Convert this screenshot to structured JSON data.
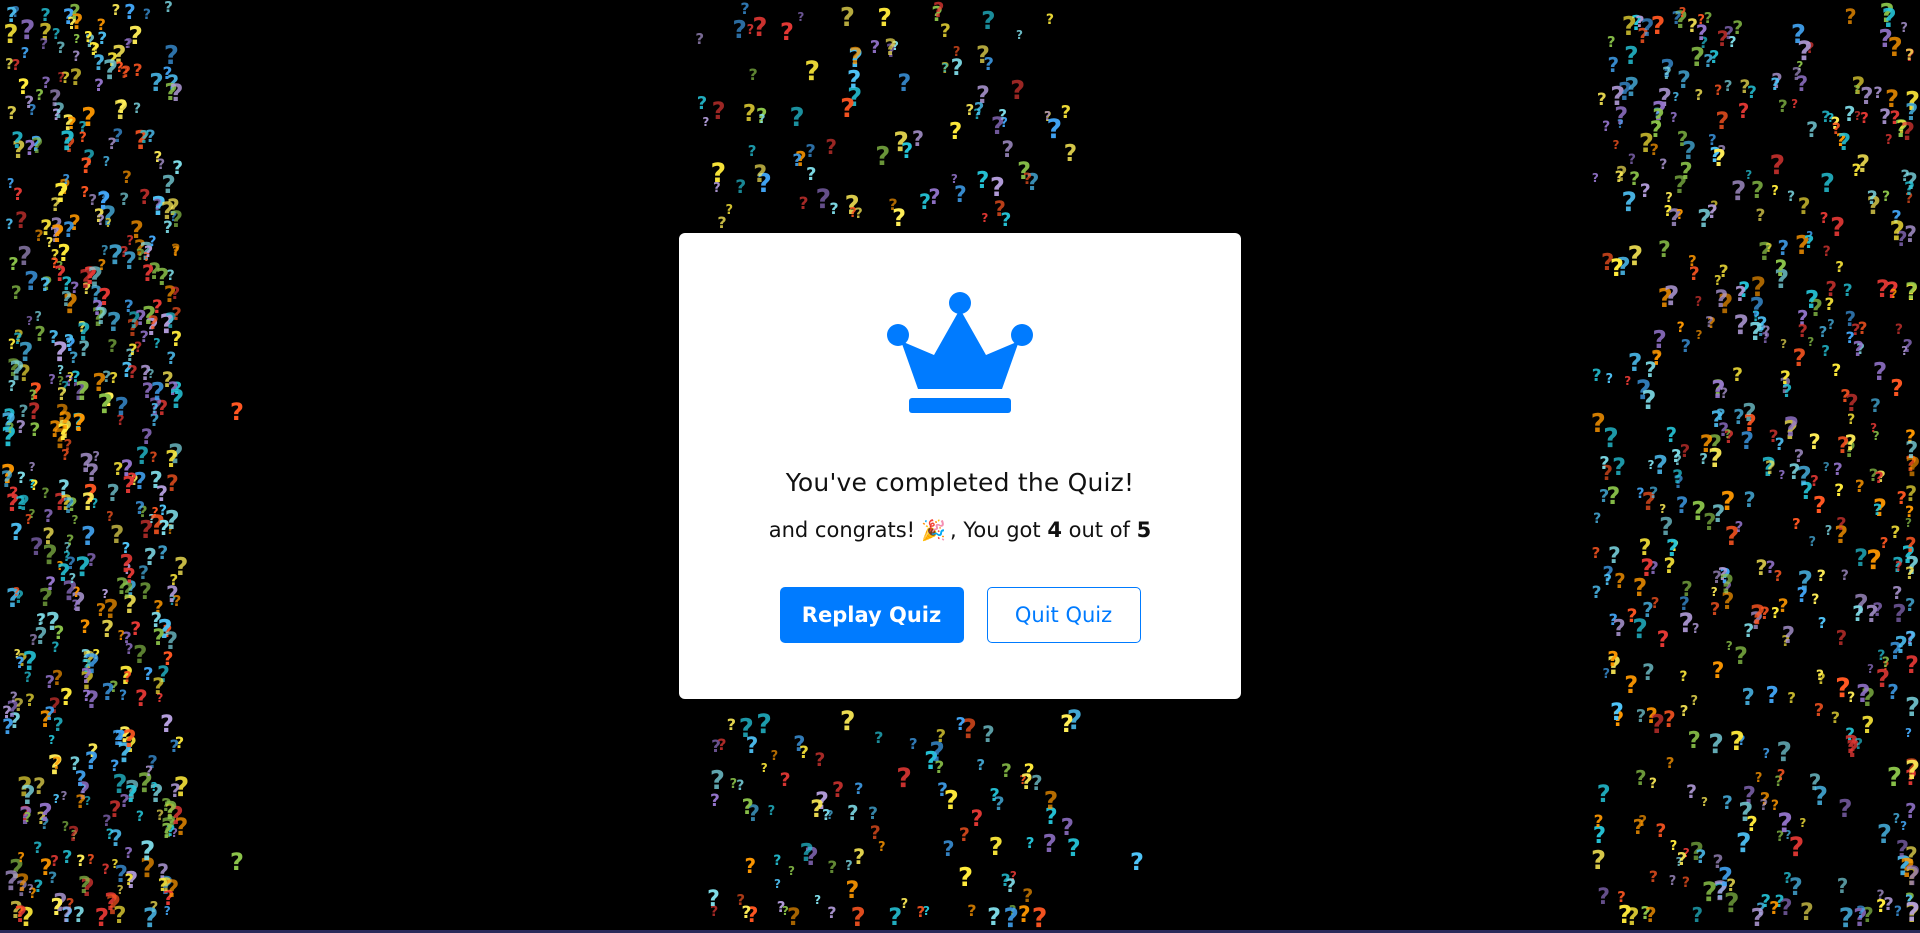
{
  "result": {
    "title": "You've completed the Quiz!",
    "score_prefix": "and congrats!",
    "score_emoji": "🎉",
    "score_mid": ", You got",
    "score_value": "4",
    "score_connector": "out of",
    "score_total": "5",
    "replay_label": "Replay Quiz",
    "quit_label": "Quit Quiz",
    "icon": "crown-icon"
  },
  "colors": {
    "accent": "#007bff",
    "background": "#000000",
    "card": "#ffffff",
    "question_marks": [
      "#ffeb3b",
      "#ff5722",
      "#4fc3f7",
      "#9575cd",
      "#8bc34a",
      "#26c6da",
      "#ff9800",
      "#e53935",
      "#42a5f5",
      "#ffee58",
      "#80deea",
      "#b39ddb"
    ]
  },
  "background_glyph": "?"
}
